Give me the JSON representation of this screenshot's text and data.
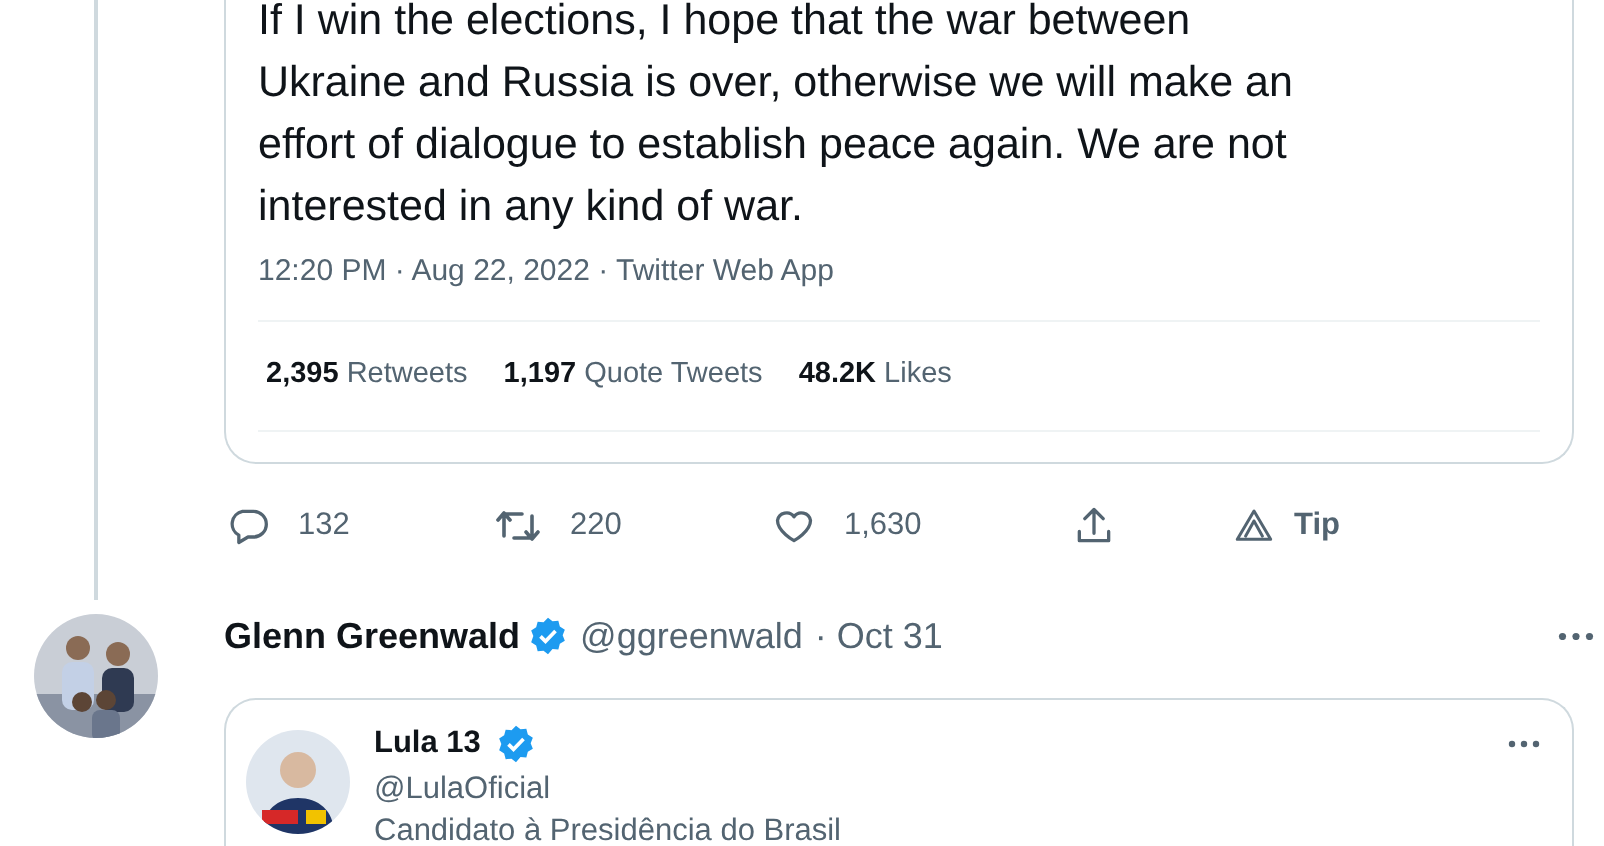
{
  "quoted_tweet": {
    "text_lines": [
      "If I win the elections, I hope that the war between",
      "Ukraine and Russia is over, otherwise we will make an",
      "effort of dialogue to establish peace again. We are not",
      "interested in any kind of war."
    ],
    "meta": "12:20 PM · Aug 22, 2022 · Twitter Web App",
    "stats": [
      {
        "count": "2,395",
        "label": "Retweets"
      },
      {
        "count": "1,197",
        "label": "Quote Tweets"
      },
      {
        "count": "48.2K",
        "label": "Likes"
      }
    ]
  },
  "actions": [
    {
      "kind": "reply",
      "count": "132"
    },
    {
      "kind": "retweet",
      "count": "220"
    },
    {
      "kind": "like",
      "count": "1,630"
    },
    {
      "kind": "share"
    },
    {
      "kind": "tip",
      "count": "Tip"
    }
  ],
  "tweet": {
    "name": "Glenn Greenwald",
    "verified": true,
    "handle": "@ggreenwald",
    "time": "· Oct 31",
    "quote": {
      "name": "Lula 13",
      "verified": true,
      "handle": "@LulaOficial",
      "bio": "Candidato à Presidência do Brasil"
    }
  }
}
